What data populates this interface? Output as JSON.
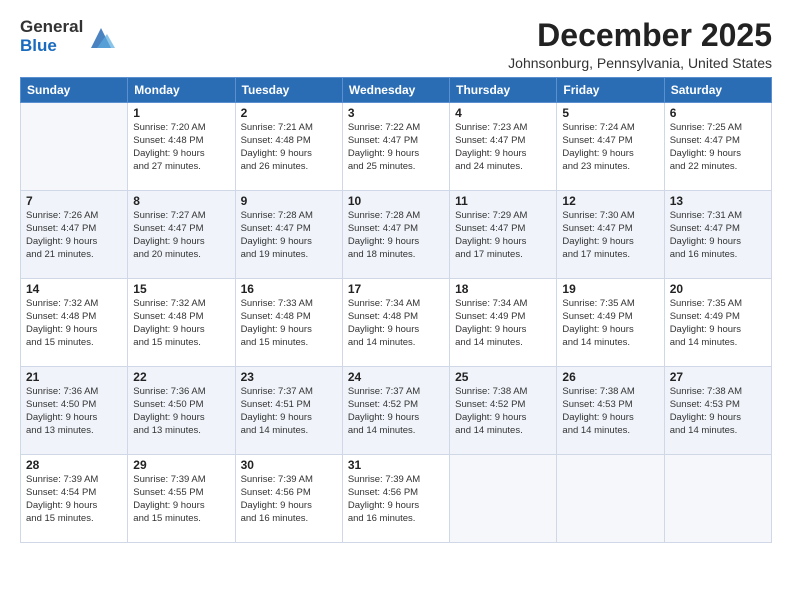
{
  "logo": {
    "general": "General",
    "blue": "Blue"
  },
  "title": "December 2025",
  "location": "Johnsonburg, Pennsylvania, United States",
  "days_of_week": [
    "Sunday",
    "Monday",
    "Tuesday",
    "Wednesday",
    "Thursday",
    "Friday",
    "Saturday"
  ],
  "weeks": [
    [
      {
        "day": "",
        "empty": true,
        "lines": []
      },
      {
        "day": "1",
        "lines": [
          "Sunrise: 7:20 AM",
          "Sunset: 4:48 PM",
          "Daylight: 9 hours",
          "and 27 minutes."
        ]
      },
      {
        "day": "2",
        "lines": [
          "Sunrise: 7:21 AM",
          "Sunset: 4:48 PM",
          "Daylight: 9 hours",
          "and 26 minutes."
        ]
      },
      {
        "day": "3",
        "lines": [
          "Sunrise: 7:22 AM",
          "Sunset: 4:47 PM",
          "Daylight: 9 hours",
          "and 25 minutes."
        ]
      },
      {
        "day": "4",
        "lines": [
          "Sunrise: 7:23 AM",
          "Sunset: 4:47 PM",
          "Daylight: 9 hours",
          "and 24 minutes."
        ]
      },
      {
        "day": "5",
        "lines": [
          "Sunrise: 7:24 AM",
          "Sunset: 4:47 PM",
          "Daylight: 9 hours",
          "and 23 minutes."
        ]
      },
      {
        "day": "6",
        "lines": [
          "Sunrise: 7:25 AM",
          "Sunset: 4:47 PM",
          "Daylight: 9 hours",
          "and 22 minutes."
        ]
      }
    ],
    [
      {
        "day": "7",
        "lines": [
          "Sunrise: 7:26 AM",
          "Sunset: 4:47 PM",
          "Daylight: 9 hours",
          "and 21 minutes."
        ]
      },
      {
        "day": "8",
        "lines": [
          "Sunrise: 7:27 AM",
          "Sunset: 4:47 PM",
          "Daylight: 9 hours",
          "and 20 minutes."
        ]
      },
      {
        "day": "9",
        "lines": [
          "Sunrise: 7:28 AM",
          "Sunset: 4:47 PM",
          "Daylight: 9 hours",
          "and 19 minutes."
        ]
      },
      {
        "day": "10",
        "lines": [
          "Sunrise: 7:28 AM",
          "Sunset: 4:47 PM",
          "Daylight: 9 hours",
          "and 18 minutes."
        ]
      },
      {
        "day": "11",
        "lines": [
          "Sunrise: 7:29 AM",
          "Sunset: 4:47 PM",
          "Daylight: 9 hours",
          "and 17 minutes."
        ]
      },
      {
        "day": "12",
        "lines": [
          "Sunrise: 7:30 AM",
          "Sunset: 4:47 PM",
          "Daylight: 9 hours",
          "and 17 minutes."
        ]
      },
      {
        "day": "13",
        "lines": [
          "Sunrise: 7:31 AM",
          "Sunset: 4:47 PM",
          "Daylight: 9 hours",
          "and 16 minutes."
        ]
      }
    ],
    [
      {
        "day": "14",
        "lines": [
          "Sunrise: 7:32 AM",
          "Sunset: 4:48 PM",
          "Daylight: 9 hours",
          "and 15 minutes."
        ]
      },
      {
        "day": "15",
        "lines": [
          "Sunrise: 7:32 AM",
          "Sunset: 4:48 PM",
          "Daylight: 9 hours",
          "and 15 minutes."
        ]
      },
      {
        "day": "16",
        "lines": [
          "Sunrise: 7:33 AM",
          "Sunset: 4:48 PM",
          "Daylight: 9 hours",
          "and 15 minutes."
        ]
      },
      {
        "day": "17",
        "lines": [
          "Sunrise: 7:34 AM",
          "Sunset: 4:48 PM",
          "Daylight: 9 hours",
          "and 14 minutes."
        ]
      },
      {
        "day": "18",
        "lines": [
          "Sunrise: 7:34 AM",
          "Sunset: 4:49 PM",
          "Daylight: 9 hours",
          "and 14 minutes."
        ]
      },
      {
        "day": "19",
        "lines": [
          "Sunrise: 7:35 AM",
          "Sunset: 4:49 PM",
          "Daylight: 9 hours",
          "and 14 minutes."
        ]
      },
      {
        "day": "20",
        "lines": [
          "Sunrise: 7:35 AM",
          "Sunset: 4:49 PM",
          "Daylight: 9 hours",
          "and 14 minutes."
        ]
      }
    ],
    [
      {
        "day": "21",
        "lines": [
          "Sunrise: 7:36 AM",
          "Sunset: 4:50 PM",
          "Daylight: 9 hours",
          "and 13 minutes."
        ]
      },
      {
        "day": "22",
        "lines": [
          "Sunrise: 7:36 AM",
          "Sunset: 4:50 PM",
          "Daylight: 9 hours",
          "and 13 minutes."
        ]
      },
      {
        "day": "23",
        "lines": [
          "Sunrise: 7:37 AM",
          "Sunset: 4:51 PM",
          "Daylight: 9 hours",
          "and 14 minutes."
        ]
      },
      {
        "day": "24",
        "lines": [
          "Sunrise: 7:37 AM",
          "Sunset: 4:52 PM",
          "Daylight: 9 hours",
          "and 14 minutes."
        ]
      },
      {
        "day": "25",
        "lines": [
          "Sunrise: 7:38 AM",
          "Sunset: 4:52 PM",
          "Daylight: 9 hours",
          "and 14 minutes."
        ]
      },
      {
        "day": "26",
        "lines": [
          "Sunrise: 7:38 AM",
          "Sunset: 4:53 PM",
          "Daylight: 9 hours",
          "and 14 minutes."
        ]
      },
      {
        "day": "27",
        "lines": [
          "Sunrise: 7:38 AM",
          "Sunset: 4:53 PM",
          "Daylight: 9 hours",
          "and 14 minutes."
        ]
      }
    ],
    [
      {
        "day": "28",
        "lines": [
          "Sunrise: 7:39 AM",
          "Sunset: 4:54 PM",
          "Daylight: 9 hours",
          "and 15 minutes."
        ]
      },
      {
        "day": "29",
        "lines": [
          "Sunrise: 7:39 AM",
          "Sunset: 4:55 PM",
          "Daylight: 9 hours",
          "and 15 minutes."
        ]
      },
      {
        "day": "30",
        "lines": [
          "Sunrise: 7:39 AM",
          "Sunset: 4:56 PM",
          "Daylight: 9 hours",
          "and 16 minutes."
        ]
      },
      {
        "day": "31",
        "lines": [
          "Sunrise: 7:39 AM",
          "Sunset: 4:56 PM",
          "Daylight: 9 hours",
          "and 16 minutes."
        ]
      },
      {
        "day": "",
        "empty": true,
        "lines": []
      },
      {
        "day": "",
        "empty": true,
        "lines": []
      },
      {
        "day": "",
        "empty": true,
        "lines": []
      }
    ]
  ]
}
